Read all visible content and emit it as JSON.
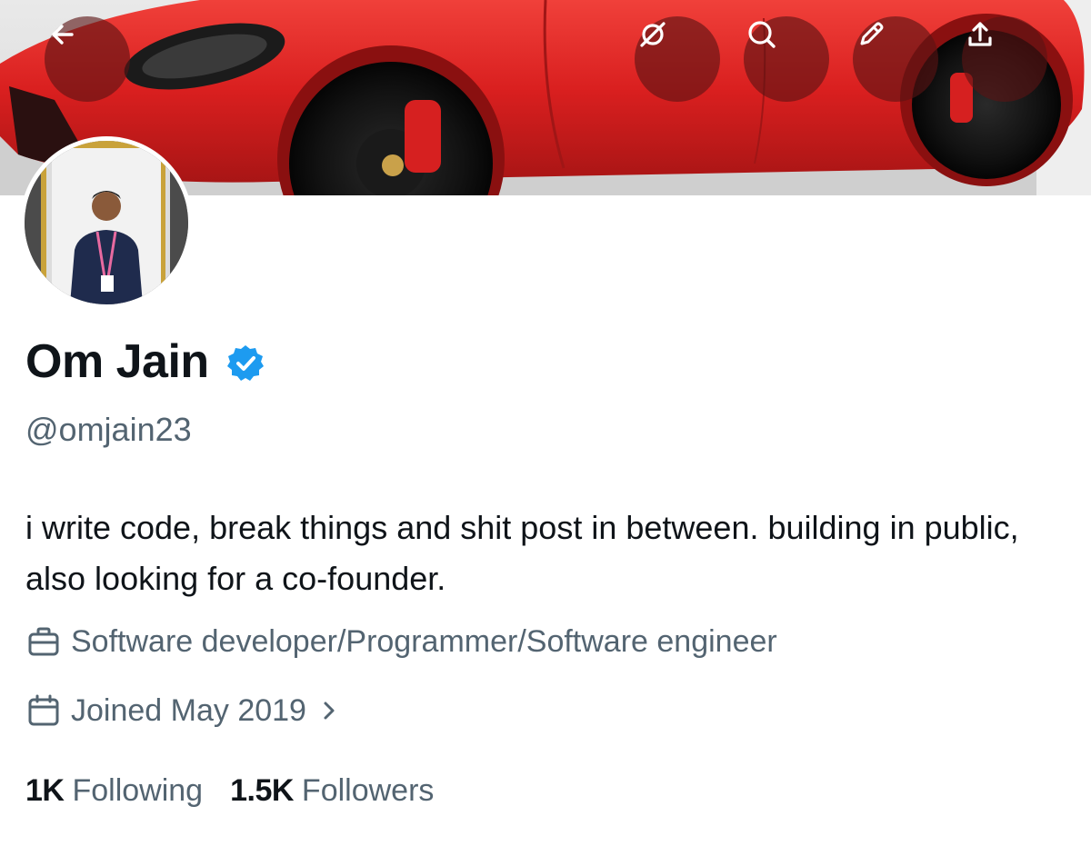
{
  "banner": {
    "description_icon": "car-banner",
    "buttons": [
      {
        "name": "back-arrow-icon"
      },
      {
        "name": "grok-icon"
      },
      {
        "name": "search-icon"
      },
      {
        "name": "edit-pencil-icon"
      },
      {
        "name": "share-upload-icon"
      }
    ]
  },
  "profile": {
    "display_name": "Om Jain",
    "handle": "@omjain23",
    "verified": true,
    "verified_color": "#1d9bf0",
    "bio": "i write code, break things and shit post in between. building in public, also looking for a co-founder.",
    "profession": "Software developer/Programmer/Software engineer",
    "joined": "Joined May 2019"
  },
  "stats": {
    "following_count": "1K",
    "following_label": "Following",
    "followers_count": "1.5K",
    "followers_label": "Followers"
  },
  "colors": {
    "text_primary": "#0f1419",
    "text_secondary": "#536471",
    "banner_car": "#d91f1f"
  }
}
